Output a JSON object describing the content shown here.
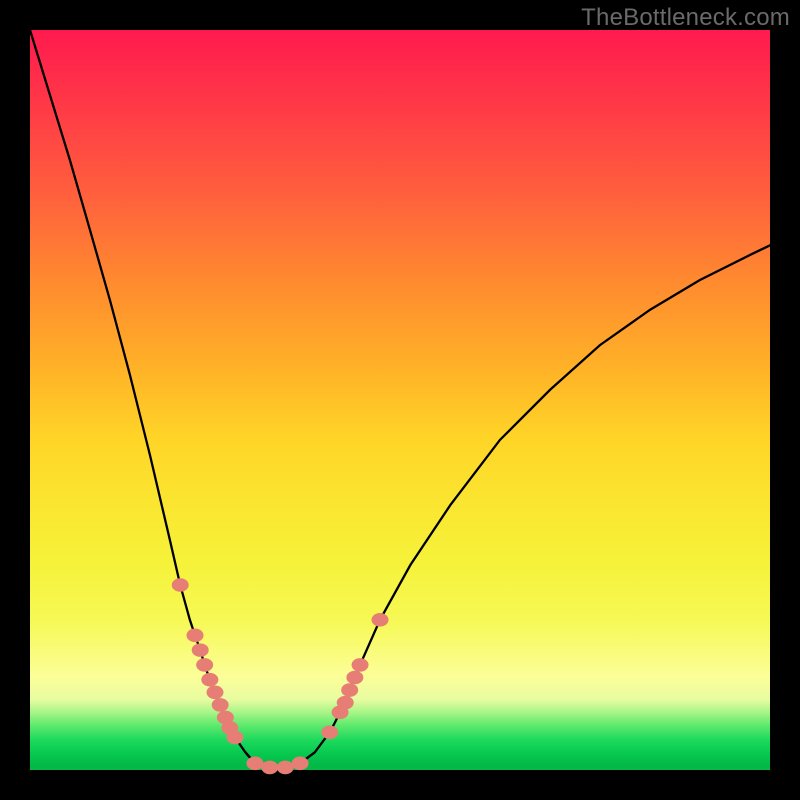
{
  "watermark": "TheBottleneck.com",
  "colors": {
    "frame": "#000000",
    "marker": "#e77e75",
    "curve": "#000000"
  },
  "chart_data": {
    "type": "line",
    "title": "",
    "xlabel": "",
    "ylabel": "",
    "xlim": [
      0,
      100
    ],
    "ylim": [
      0,
      100
    ],
    "grid": false,
    "legend": false,
    "annotations": [
      "TheBottleneck.com"
    ],
    "series": [
      {
        "name": "left_branch",
        "x": [
          0.0,
          2.7,
          5.4,
          8.1,
          10.8,
          13.5,
          16.2,
          18.9,
          20.3,
          21.6,
          22.3,
          23.0,
          23.6,
          24.3,
          25.0,
          25.7,
          26.4,
          27.0,
          27.7,
          28.4,
          29.1,
          30.4
        ],
        "y": [
          100,
          91.2,
          82.4,
          73.0,
          63.5,
          53.4,
          42.6,
          31.1,
          25.0,
          20.3,
          18.2,
          16.2,
          14.2,
          12.2,
          10.5,
          8.8,
          7.1,
          5.7,
          4.4,
          3.4,
          2.4,
          0.9
        ]
      },
      {
        "name": "valley_floor",
        "x": [
          29.1,
          30.4,
          32.4,
          34.5,
          36.5,
          38.5
        ],
        "y": [
          2.4,
          0.9,
          0.35,
          0.35,
          0.9,
          2.4
        ]
      },
      {
        "name": "right_branch",
        "x": [
          36.5,
          38.5,
          40.5,
          41.2,
          41.9,
          42.6,
          43.2,
          43.9,
          44.6,
          47.3,
          51.4,
          56.8,
          63.5,
          70.3,
          77.0,
          83.8,
          90.5,
          97.3,
          100.0
        ],
        "y": [
          0.9,
          2.4,
          5.1,
          6.4,
          7.8,
          9.1,
          10.8,
          12.5,
          14.2,
          20.3,
          27.7,
          35.8,
          44.6,
          51.4,
          57.4,
          62.2,
          66.2,
          69.6,
          70.9
        ]
      }
    ],
    "markers": [
      {
        "series": "left_branch",
        "indices": [
          8,
          10,
          11,
          12,
          13,
          14,
          15,
          16,
          17,
          18
        ]
      },
      {
        "series": "valley_floor",
        "indices": [
          1,
          2,
          3,
          4
        ]
      },
      {
        "series": "right_branch",
        "indices": [
          2,
          4,
          5,
          6,
          7,
          8,
          9
        ]
      }
    ]
  }
}
